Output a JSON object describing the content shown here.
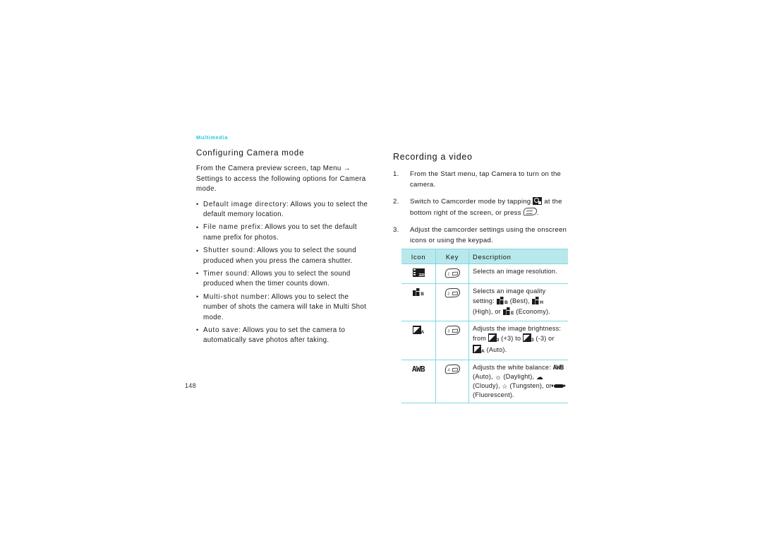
{
  "document": {
    "section_tag": "Multimedia",
    "page_number": "148"
  },
  "left_column": {
    "heading": "Configuring Camera mode",
    "intro": "From the Camera preview screen, tap Menu → Settings to access the following options for Camera mode.",
    "bullets": [
      {
        "term": "Default image directory",
        "text": ": Allows you to select the default memory location."
      },
      {
        "term": "File name prefix",
        "text": ": Allows you to set the default name prefix for photos."
      },
      {
        "term": "Shutter sound",
        "text": ": Allows you to select the sound produced when you press the camera shutter."
      },
      {
        "term": "Timer sound",
        "text": ": Allows you to select the sound produced when the timer counts down."
      },
      {
        "term": "Multi-shot number",
        "text": ": Allows you to select the number of shots the camera will take in Multi Shot mode."
      },
      {
        "term": "Auto save",
        "text": ": Allows you to set the camera to automatically save photos after taking."
      }
    ]
  },
  "right_column": {
    "heading": "Recording a video",
    "steps": [
      {
        "num": "1.",
        "text_before": "From the Start menu, tap Camera to turn on the camera.",
        "text_after": ""
      },
      {
        "num": "2.",
        "text_before": "Switch to Camcorder mode by tapping ",
        "text_mid": " at the bottom right of the screen, or press ",
        "text_after": "."
      },
      {
        "num": "3.",
        "text_before": "Adjust the camcorder settings using the onscreen icons or using the keypad.",
        "text_after": ""
      }
    ]
  },
  "table": {
    "headers": [
      "Icon",
      "Key",
      "Description"
    ],
    "rows": [
      {
        "icon_name": "resolution-icon",
        "icon_label": "320",
        "key_name": "key-1",
        "key_label": "1",
        "description": "Selects an image resolution."
      },
      {
        "icon_name": "image-quality-icon",
        "icon_label": "B",
        "key_name": "key-2",
        "key_label": "2",
        "description_start": "Selects an image quality setting: ",
        "quality_best_label": "B",
        "quality_best_name": "(Best), ",
        "quality_high_label": "H",
        "quality_high_name": "(High), or ",
        "quality_econ_label": "E",
        "quality_econ_name": "(Economy)."
      },
      {
        "icon_name": "brightness-icon",
        "icon_label": "A",
        "key_name": "key-3",
        "key_label": "3",
        "description_start": "Adjusts the image brightness: from ",
        "bright_plus_label": "3",
        "bright_plus_value": "(+3) to ",
        "bright_minus_label": "3",
        "bright_minus_value": "(-3) or ",
        "bright_auto_label": "A",
        "bright_auto_value": "(Auto)."
      },
      {
        "icon_name": "white-balance-icon",
        "icon_label": "AWB",
        "key_name": "key-4",
        "key_label": "4",
        "description_start": "Adjusts the white balance: ",
        "wb_auto_label": "AWB",
        "wb_auto_value": "(Auto), ",
        "wb_daylight_value": "(Daylight), ",
        "wb_cloudy_value": "(Cloudy), ",
        "wb_tungsten_value": "(Tungsten), or ",
        "wb_fluorescent_value": "(Fluorescent)."
      }
    ]
  },
  "colors": {
    "accent_cyan": "#25c7e0",
    "table_header_bg": "#b8e8ec",
    "table_border": "#7fd9e4",
    "text": "#1a1a1a"
  }
}
